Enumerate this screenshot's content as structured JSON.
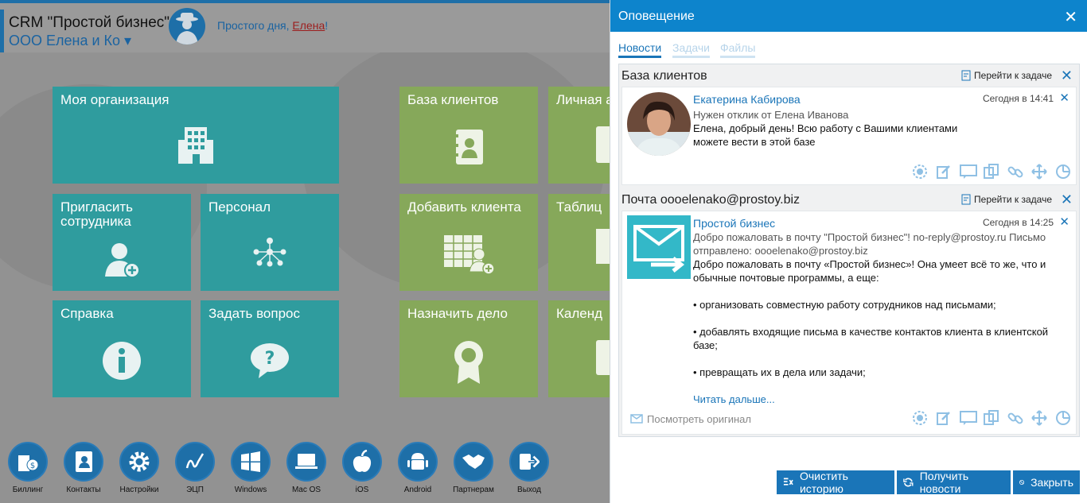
{
  "header": {
    "app_title": "CRM \"Простой бизнес\"",
    "org_name": "ООО Елена и Ко ▾",
    "greeting_prefix": "Простого дня, ",
    "greeting_user": "Елена",
    "greeting_suffix": "!"
  },
  "tiles": {
    "my_org": "Моя организация",
    "invite": "Пригласить сотрудника",
    "staff": "Персонал",
    "help": "Справка",
    "ask": "Задать вопрос",
    "clients": "База клиентов",
    "personal": "Личная а",
    "add_client": "Добавить клиента",
    "tables": "Таблиц",
    "assign": "Назначить дело",
    "calendar": "Календ"
  },
  "dock": [
    {
      "label": "Биллинг",
      "icon": "billing-icon"
    },
    {
      "label": "Контакты",
      "icon": "contacts-icon"
    },
    {
      "label": "Настройки",
      "icon": "settings-icon"
    },
    {
      "label": "ЭЦП",
      "icon": "signature-icon"
    },
    {
      "label": "Windows",
      "icon": "windows-icon"
    },
    {
      "label": "Mac OS",
      "icon": "macos-icon"
    },
    {
      "label": "iOS",
      "icon": "apple-icon"
    },
    {
      "label": "Android",
      "icon": "android-icon"
    },
    {
      "label": "Партнерам",
      "icon": "handshake-icon"
    },
    {
      "label": "Выход",
      "icon": "exit-icon"
    }
  ],
  "panel": {
    "title": "Оповещение",
    "tabs": [
      "Новости",
      "Задачи",
      "Файлы"
    ],
    "goto_label": "Перейти к задаче",
    "cards": [
      {
        "title": "База клиентов",
        "author": "Екатерина Кабирова",
        "date": "Сегодня в 14:41",
        "sub": "Нужен отклик от Елена Иванова",
        "text": "Елена, добрый день! Всю работу с Вашими клиентами можете вести в этой базе"
      },
      {
        "title": "Почта oooelenako@prostoy.biz",
        "author": "Простой бизнес",
        "date": "Сегодня в 14:25",
        "sub": "Добро пожаловать в почту \"Простой бизнес\"! no-reply@prostoy.ru Письмо отправлено: oooelenako@prostoy.biz",
        "text1": "Добро пожаловать в почту «Простой бизнес»! Она умеет всё то же, что и обычные почтовые программы, а еще:",
        "bullet1": "• организовать совместную работу сотрудников над письмами;",
        "bullet2": "• добавлять входящие письма в качестве контактов клиента в клиентской базе;",
        "bullet3": "• превращать их в дела или задачи;",
        "read_more": "Читать дальше...",
        "view_original": "Посмотреть оригинал"
      }
    ],
    "buttons": {
      "clear": "Очистить историю",
      "fetch": "Получить новости",
      "close": "Закрыть"
    }
  },
  "colors": {
    "accent": "#1a75b8",
    "teal_tile": "#2f9c9e",
    "green_tile": "#86a85a"
  }
}
